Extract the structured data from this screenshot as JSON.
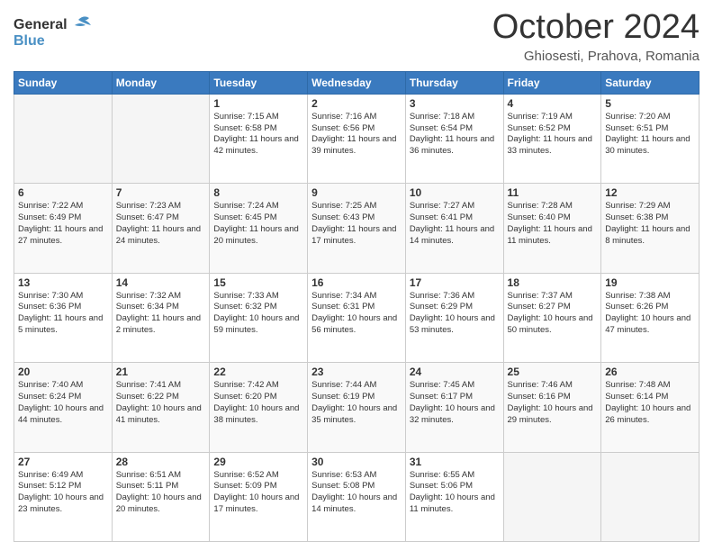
{
  "header": {
    "logo_line1": "General",
    "logo_line2": "Blue",
    "month": "October 2024",
    "location": "Ghiosesti, Prahova, Romania"
  },
  "days_of_week": [
    "Sunday",
    "Monday",
    "Tuesday",
    "Wednesday",
    "Thursday",
    "Friday",
    "Saturday"
  ],
  "weeks": [
    [
      {
        "day": "",
        "sunrise": "",
        "sunset": "",
        "daylight": ""
      },
      {
        "day": "",
        "sunrise": "",
        "sunset": "",
        "daylight": ""
      },
      {
        "day": "1",
        "sunrise": "Sunrise: 7:15 AM",
        "sunset": "Sunset: 6:58 PM",
        "daylight": "Daylight: 11 hours and 42 minutes."
      },
      {
        "day": "2",
        "sunrise": "Sunrise: 7:16 AM",
        "sunset": "Sunset: 6:56 PM",
        "daylight": "Daylight: 11 hours and 39 minutes."
      },
      {
        "day": "3",
        "sunrise": "Sunrise: 7:18 AM",
        "sunset": "Sunset: 6:54 PM",
        "daylight": "Daylight: 11 hours and 36 minutes."
      },
      {
        "day": "4",
        "sunrise": "Sunrise: 7:19 AM",
        "sunset": "Sunset: 6:52 PM",
        "daylight": "Daylight: 11 hours and 33 minutes."
      },
      {
        "day": "5",
        "sunrise": "Sunrise: 7:20 AM",
        "sunset": "Sunset: 6:51 PM",
        "daylight": "Daylight: 11 hours and 30 minutes."
      }
    ],
    [
      {
        "day": "6",
        "sunrise": "Sunrise: 7:22 AM",
        "sunset": "Sunset: 6:49 PM",
        "daylight": "Daylight: 11 hours and 27 minutes."
      },
      {
        "day": "7",
        "sunrise": "Sunrise: 7:23 AM",
        "sunset": "Sunset: 6:47 PM",
        "daylight": "Daylight: 11 hours and 24 minutes."
      },
      {
        "day": "8",
        "sunrise": "Sunrise: 7:24 AM",
        "sunset": "Sunset: 6:45 PM",
        "daylight": "Daylight: 11 hours and 20 minutes."
      },
      {
        "day": "9",
        "sunrise": "Sunrise: 7:25 AM",
        "sunset": "Sunset: 6:43 PM",
        "daylight": "Daylight: 11 hours and 17 minutes."
      },
      {
        "day": "10",
        "sunrise": "Sunrise: 7:27 AM",
        "sunset": "Sunset: 6:41 PM",
        "daylight": "Daylight: 11 hours and 14 minutes."
      },
      {
        "day": "11",
        "sunrise": "Sunrise: 7:28 AM",
        "sunset": "Sunset: 6:40 PM",
        "daylight": "Daylight: 11 hours and 11 minutes."
      },
      {
        "day": "12",
        "sunrise": "Sunrise: 7:29 AM",
        "sunset": "Sunset: 6:38 PM",
        "daylight": "Daylight: 11 hours and 8 minutes."
      }
    ],
    [
      {
        "day": "13",
        "sunrise": "Sunrise: 7:30 AM",
        "sunset": "Sunset: 6:36 PM",
        "daylight": "Daylight: 11 hours and 5 minutes."
      },
      {
        "day": "14",
        "sunrise": "Sunrise: 7:32 AM",
        "sunset": "Sunset: 6:34 PM",
        "daylight": "Daylight: 11 hours and 2 minutes."
      },
      {
        "day": "15",
        "sunrise": "Sunrise: 7:33 AM",
        "sunset": "Sunset: 6:32 PM",
        "daylight": "Daylight: 10 hours and 59 minutes."
      },
      {
        "day": "16",
        "sunrise": "Sunrise: 7:34 AM",
        "sunset": "Sunset: 6:31 PM",
        "daylight": "Daylight: 10 hours and 56 minutes."
      },
      {
        "day": "17",
        "sunrise": "Sunrise: 7:36 AM",
        "sunset": "Sunset: 6:29 PM",
        "daylight": "Daylight: 10 hours and 53 minutes."
      },
      {
        "day": "18",
        "sunrise": "Sunrise: 7:37 AM",
        "sunset": "Sunset: 6:27 PM",
        "daylight": "Daylight: 10 hours and 50 minutes."
      },
      {
        "day": "19",
        "sunrise": "Sunrise: 7:38 AM",
        "sunset": "Sunset: 6:26 PM",
        "daylight": "Daylight: 10 hours and 47 minutes."
      }
    ],
    [
      {
        "day": "20",
        "sunrise": "Sunrise: 7:40 AM",
        "sunset": "Sunset: 6:24 PM",
        "daylight": "Daylight: 10 hours and 44 minutes."
      },
      {
        "day": "21",
        "sunrise": "Sunrise: 7:41 AM",
        "sunset": "Sunset: 6:22 PM",
        "daylight": "Daylight: 10 hours and 41 minutes."
      },
      {
        "day": "22",
        "sunrise": "Sunrise: 7:42 AM",
        "sunset": "Sunset: 6:20 PM",
        "daylight": "Daylight: 10 hours and 38 minutes."
      },
      {
        "day": "23",
        "sunrise": "Sunrise: 7:44 AM",
        "sunset": "Sunset: 6:19 PM",
        "daylight": "Daylight: 10 hours and 35 minutes."
      },
      {
        "day": "24",
        "sunrise": "Sunrise: 7:45 AM",
        "sunset": "Sunset: 6:17 PM",
        "daylight": "Daylight: 10 hours and 32 minutes."
      },
      {
        "day": "25",
        "sunrise": "Sunrise: 7:46 AM",
        "sunset": "Sunset: 6:16 PM",
        "daylight": "Daylight: 10 hours and 29 minutes."
      },
      {
        "day": "26",
        "sunrise": "Sunrise: 7:48 AM",
        "sunset": "Sunset: 6:14 PM",
        "daylight": "Daylight: 10 hours and 26 minutes."
      }
    ],
    [
      {
        "day": "27",
        "sunrise": "Sunrise: 6:49 AM",
        "sunset": "Sunset: 5:12 PM",
        "daylight": "Daylight: 10 hours and 23 minutes."
      },
      {
        "day": "28",
        "sunrise": "Sunrise: 6:51 AM",
        "sunset": "Sunset: 5:11 PM",
        "daylight": "Daylight: 10 hours and 20 minutes."
      },
      {
        "day": "29",
        "sunrise": "Sunrise: 6:52 AM",
        "sunset": "Sunset: 5:09 PM",
        "daylight": "Daylight: 10 hours and 17 minutes."
      },
      {
        "day": "30",
        "sunrise": "Sunrise: 6:53 AM",
        "sunset": "Sunset: 5:08 PM",
        "daylight": "Daylight: 10 hours and 14 minutes."
      },
      {
        "day": "31",
        "sunrise": "Sunrise: 6:55 AM",
        "sunset": "Sunset: 5:06 PM",
        "daylight": "Daylight: 10 hours and 11 minutes."
      },
      {
        "day": "",
        "sunrise": "",
        "sunset": "",
        "daylight": ""
      },
      {
        "day": "",
        "sunrise": "",
        "sunset": "",
        "daylight": ""
      }
    ]
  ]
}
